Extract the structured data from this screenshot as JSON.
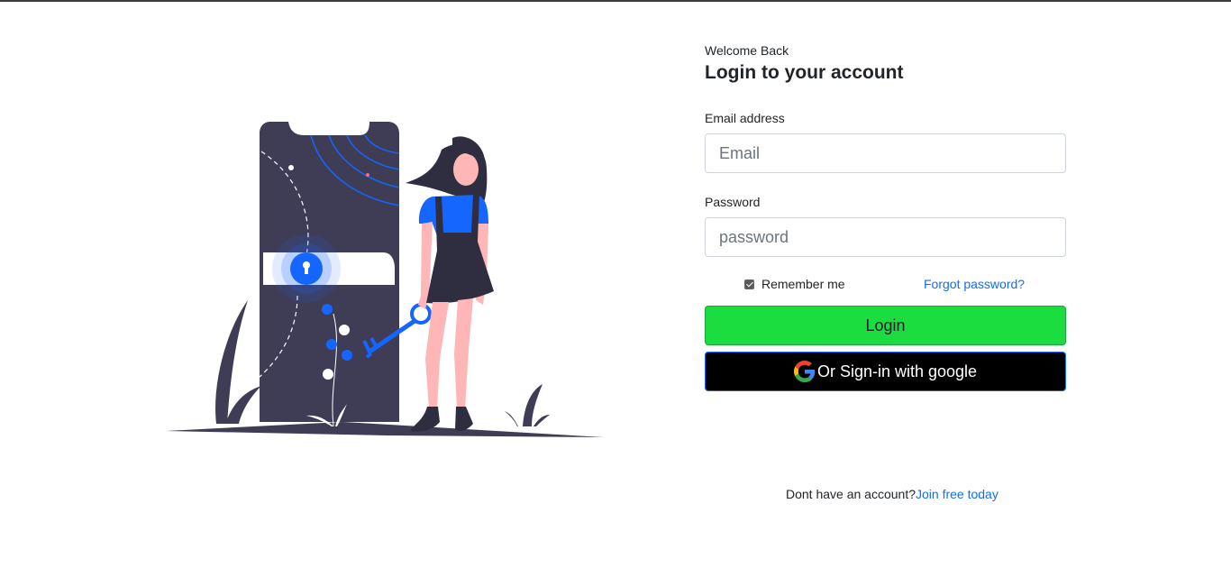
{
  "header": {
    "welcome": "Welcome Back",
    "title": "Login to your account"
  },
  "form": {
    "email_label": "Email address",
    "email_placeholder": "Email",
    "email_value": "",
    "password_label": "Password",
    "password_placeholder": "password",
    "password_value": "",
    "remember_label": "Remember me",
    "remember_checked": true,
    "forgot_label": "Forgot password?",
    "login_label": "Login",
    "google_label": "Or Sign-in with google"
  },
  "footer": {
    "prompt": "Dont have an account?",
    "link": "Join free today"
  },
  "colors": {
    "accent": "#0d6efd",
    "login_button": "#1cdd3f",
    "google_button": "#000000",
    "illustration_dark": "#3f3d56",
    "illustration_blue": "#1565ff",
    "skin": "#ffb6b6"
  },
  "icons": {
    "google": "google-g-icon",
    "keyhole": "keyhole-icon",
    "check": "check-icon"
  }
}
